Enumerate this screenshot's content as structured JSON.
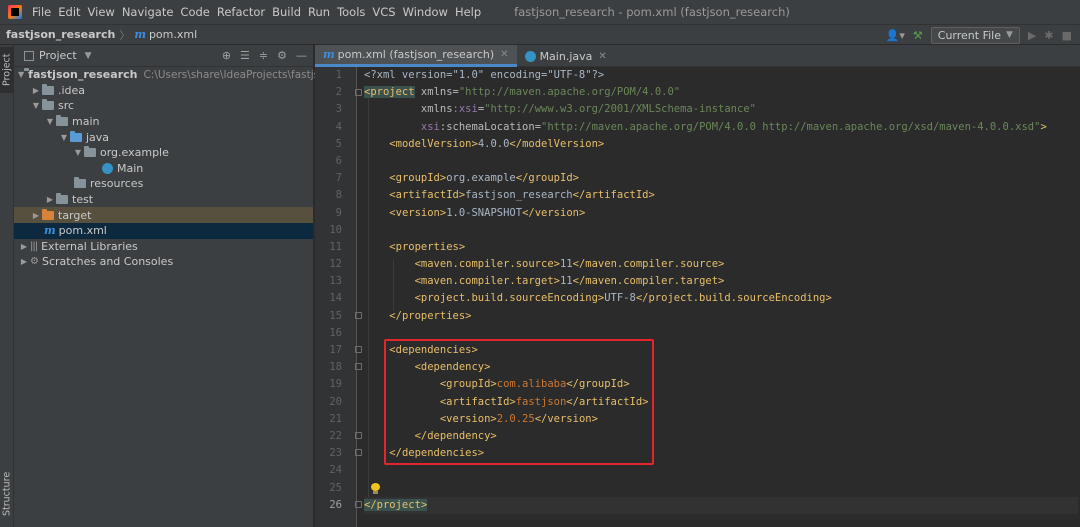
{
  "menubar": {
    "items": [
      "File",
      "Edit",
      "View",
      "Navigate",
      "Code",
      "Refactor",
      "Build",
      "Run",
      "Tools",
      "VCS",
      "Window",
      "Help"
    ],
    "window_title": "fastjson_research - pom.xml (fastjson_research)"
  },
  "navbar": {
    "project": "fastjson_research",
    "file": "pom.xml",
    "run_config": "Current File"
  },
  "left_strip": {
    "project_tab": "Project",
    "structure_tab": "Structure"
  },
  "project_panel": {
    "title": "Project",
    "tree": [
      {
        "label": "fastjson_research",
        "path": "C:\\Users\\share\\IdeaProjects\\fastjson_res"
      },
      {
        "label": ".idea"
      },
      {
        "label": "src"
      },
      {
        "label": "main"
      },
      {
        "label": "java"
      },
      {
        "label": "org.example"
      },
      {
        "label": "Main"
      },
      {
        "label": "resources"
      },
      {
        "label": "test"
      },
      {
        "label": "target"
      },
      {
        "label": "pom.xml"
      },
      {
        "label": "External Libraries"
      },
      {
        "label": "Scratches and Consoles"
      }
    ]
  },
  "tabs": [
    {
      "label": "pom.xml (fastjson_research)",
      "active": true
    },
    {
      "label": "Main.java",
      "active": false
    }
  ],
  "editor": {
    "line_numbers": [
      "1",
      "2",
      "3",
      "4",
      "5",
      "6",
      "7",
      "8",
      "9",
      "10",
      "11",
      "12",
      "13",
      "14",
      "15",
      "16",
      "17",
      "18",
      "19",
      "20",
      "21",
      "22",
      "23",
      "24",
      "25",
      "26"
    ],
    "current_line": 26,
    "code": {
      "l1": "<?xml version=\"1.0\" encoding=\"UTF-8\"?>",
      "l2_tag": "project",
      "l2_attr": "xmlns",
      "l2_val": "\"http://maven.apache.org/POM/4.0.0\"",
      "l3_ns": "xmlns",
      "l3_attr": ":xsi",
      "l3_val": "\"http://www.w3.org/2001/XMLSchema-instance\"",
      "l4_ns": "xsi",
      "l4_attr": ":schemaLocation",
      "l4_val": "\"http://maven.apache.org/POM/4.0.0 http://maven.apache.org/xsd/maven-4.0.0.xsd\"",
      "modelVersion": "4.0.0",
      "groupId": "org.example",
      "artifactId": "fastjson_research",
      "version": "1.0-SNAPSHOT",
      "compiler_source": "11",
      "compiler_target": "11",
      "source_encoding": "UTF-8",
      "dep_groupId": "com.alibaba",
      "dep_artifactId": "fastjson",
      "dep_version": "2.0.25"
    }
  },
  "colors": {
    "highlight_box": "#e3262b",
    "accent": "#4a88c7",
    "tag": "#e8bf6a",
    "attr_value": "#6a8759",
    "dependency_value": "#cc7832"
  }
}
